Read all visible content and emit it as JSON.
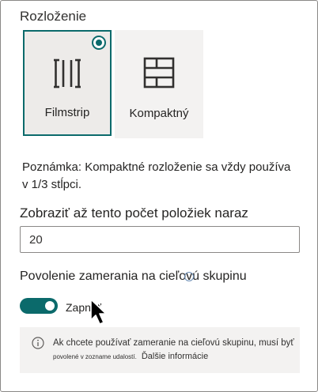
{
  "layout_section": {
    "title": "Rozloženie",
    "options": [
      {
        "label": "Filmstrip",
        "selected": true,
        "icon": "filmstrip-icon"
      },
      {
        "label": "Kompaktný",
        "selected": false,
        "icon": "compact-grid-icon"
      }
    ]
  },
  "note": "Poznámka: Kompaktné rozloženie sa vždy používa v 1/3 stĺpci.",
  "item_count": {
    "label": "Zobraziť až tento počet položiek naraz",
    "value": "20"
  },
  "audience_targeting": {
    "label": "Povolenie zamerania na cieľovú skupinu",
    "toggle_on": true,
    "toggle_text": "Zapnúť"
  },
  "info_bar": {
    "icon": "info-icon",
    "text": "Ak chcete používať zameranie na cieľovú skupinu, musí byť",
    "small_text": "povolené v zozname udalostí.",
    "link": "Ďalšie informácie"
  },
  "colors": {
    "accent": "#0b6a6b",
    "card_bg": "#f3f2f1",
    "info_bg": "#f3f2f1",
    "border": "#8a8886"
  }
}
